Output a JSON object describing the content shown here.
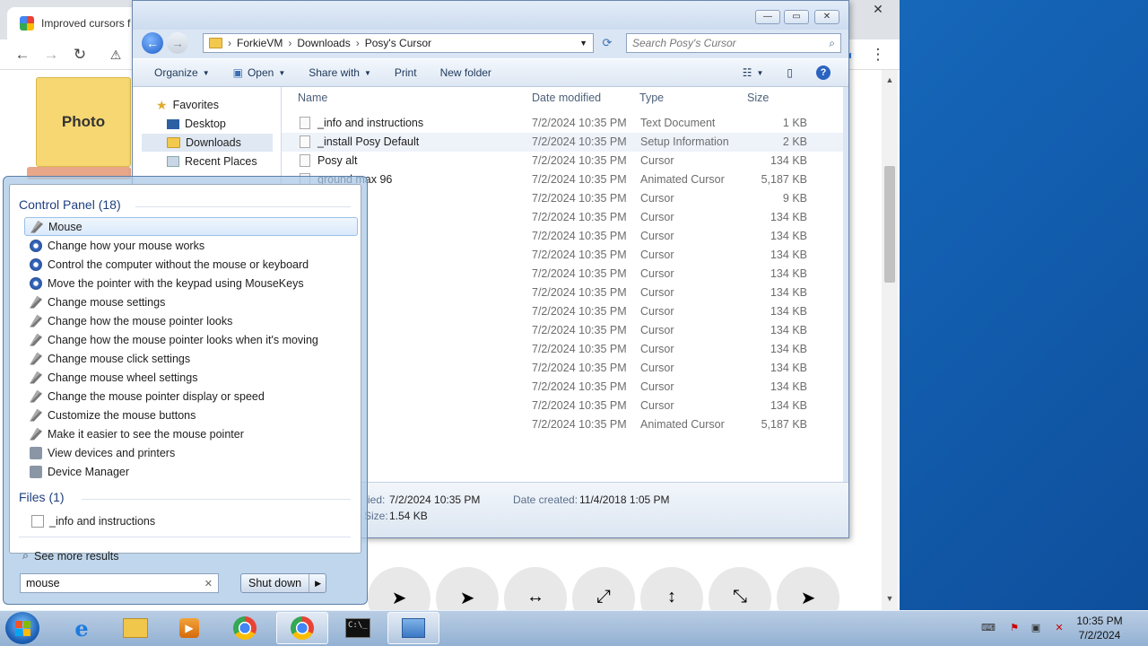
{
  "browser": {
    "tab_title": "Improved cursors f",
    "close_glyph": "✕",
    "page": {
      "photo_tile": "Photo"
    }
  },
  "explorer": {
    "window_buttons": {
      "minimize": "—",
      "maximize": "▭",
      "close": "✕"
    },
    "breadcrumb": [
      "ForkieVM",
      "Downloads",
      "Posy's Cursor"
    ],
    "search_placeholder": "Search Posy's Cursor",
    "commands": {
      "organize": "Organize",
      "open": "Open",
      "share_with": "Share with",
      "print": "Print",
      "new_folder": "New folder"
    },
    "nav": {
      "favorites": "Favorites",
      "desktop": "Desktop",
      "downloads": "Downloads",
      "recent_places": "Recent Places"
    },
    "columns": {
      "name": "Name",
      "date_modified": "Date modified",
      "type": "Type",
      "size": "Size"
    },
    "files": [
      {
        "name": "_info and instructions",
        "date": "7/2/2024 10:35 PM",
        "type": "Text Document",
        "size": "1 KB"
      },
      {
        "name": "_install Posy Default",
        "date": "7/2/2024 10:35 PM",
        "type": "Setup Information",
        "size": "2 KB"
      },
      {
        "name": "Posy alt",
        "date": "7/2/2024 10:35 PM",
        "type": "Cursor",
        "size": "134 KB"
      },
      {
        "name": "ground max 96",
        "date": "7/2/2024 10:35 PM",
        "type": "Animated Cursor",
        "size": "5,187 KB"
      },
      {
        "name": "",
        "date": "7/2/2024 10:35 PM",
        "type": "Cursor",
        "size": "9 KB"
      },
      {
        "name": "r",
        "date": "7/2/2024 10:35 PM",
        "type": "Cursor",
        "size": "134 KB"
      },
      {
        "name": "dden",
        "date": "7/2/2024 10:35 PM",
        "type": "Cursor",
        "size": "134 KB"
      },
      {
        "name": "",
        "date": "7/2/2024 10:35 PM",
        "type": "Cursor",
        "size": "134 KB"
      },
      {
        "name": "",
        "date": "7/2/2024 10:35 PM",
        "type": "Cursor",
        "size": "134 KB"
      },
      {
        "name": "",
        "date": "7/2/2024 10:35 PM",
        "type": "Cursor",
        "size": "134 KB"
      },
      {
        "name": "",
        "date": "7/2/2024 10:35 PM",
        "type": "Cursor",
        "size": "134 KB"
      },
      {
        "name": "e",
        "date": "7/2/2024 10:35 PM",
        "type": "Cursor",
        "size": "134 KB"
      },
      {
        "name": "W",
        "date": "7/2/2024 10:35 PM",
        "type": "Cursor",
        "size": "134 KB"
      },
      {
        "name": "eSw",
        "date": "7/2/2024 10:35 PM",
        "type": "Cursor",
        "size": "134 KB"
      },
      {
        "name": "S",
        "date": "7/2/2024 10:35 PM",
        "type": "Cursor",
        "size": "134 KB"
      },
      {
        "name": "wSe",
        "date": "7/2/2024 10:35 PM",
        "type": "Cursor",
        "size": "134 KB"
      },
      {
        "name": "max 96",
        "date": "7/2/2024 10:35 PM",
        "type": "Animated Cursor",
        "size": "5,187 KB"
      }
    ],
    "details": {
      "modified_label": "ied:",
      "modified_value": "7/2/2024 10:35 PM",
      "created_label": "Date created:",
      "created_value": "11/4/2018 1:05 PM",
      "size_label": "Size:",
      "size_value": "1.54 KB"
    }
  },
  "start_menu": {
    "control_panel_header": "Control Panel (18)",
    "control_panel_items": [
      {
        "label": "Mouse",
        "icon": "mouse-icon"
      },
      {
        "label": "Change how your mouse works",
        "icon": "ease-of-access-icon"
      },
      {
        "label": "Control the computer without the mouse or keyboard",
        "icon": "ease-of-access-icon"
      },
      {
        "label": "Move the pointer with the keypad using MouseKeys",
        "icon": "ease-of-access-icon"
      },
      {
        "label": "Change mouse settings",
        "icon": "mouse-icon"
      },
      {
        "label": "Change how the mouse pointer looks",
        "icon": "mouse-icon"
      },
      {
        "label": "Change how the mouse pointer looks when it's moving",
        "icon": "mouse-icon"
      },
      {
        "label": "Change mouse click settings",
        "icon": "mouse-icon"
      },
      {
        "label": "Change mouse wheel settings",
        "icon": "mouse-icon"
      },
      {
        "label": "Change the mouse pointer display or speed",
        "icon": "mouse-icon"
      },
      {
        "label": "Customize the mouse buttons",
        "icon": "mouse-icon"
      },
      {
        "label": "Make it easier to see the mouse pointer",
        "icon": "mouse-icon"
      },
      {
        "label": "View devices and printers",
        "icon": "devices-icon"
      },
      {
        "label": "Device Manager",
        "icon": "devices-icon"
      }
    ],
    "files_header": "Files (1)",
    "files_items": [
      "_info and instructions"
    ],
    "see_more": "See more results",
    "search_value": "mouse",
    "clear_glyph": "✕",
    "shutdown_label": "Shut down"
  },
  "taskbar": {
    "time": "10:35 PM",
    "date": "7/2/2024"
  }
}
